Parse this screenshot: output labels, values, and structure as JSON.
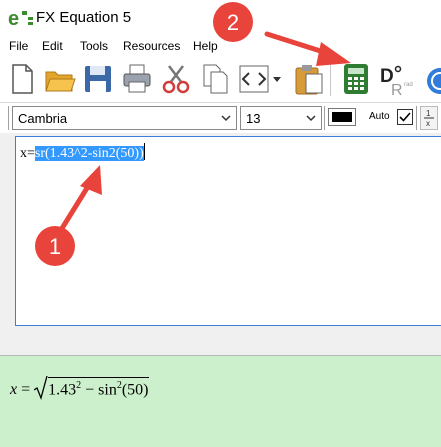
{
  "window": {
    "title": "FX Equation 5"
  },
  "menu": {
    "items": [
      "File",
      "Edit",
      "Tools",
      "Resources",
      "Help"
    ]
  },
  "format": {
    "font": "Cambria",
    "size": "13",
    "auto_label": "Auto",
    "color": "#000000"
  },
  "editor": {
    "prefix": "x=",
    "selected_text": "sr(1.43^2-sin2(50))"
  },
  "preview": {
    "var": "x",
    "eq": "=",
    "base": "1.43",
    "exp1": "2",
    "minus": "−",
    "func": "sin",
    "exp2": "2",
    "arg": "(50)"
  },
  "annotations": {
    "marker1": "1",
    "marker2": "2"
  },
  "colors": {
    "selection": "#3399ff",
    "preview_bg": "#ccf0cc",
    "annotation": "#e8443b"
  }
}
